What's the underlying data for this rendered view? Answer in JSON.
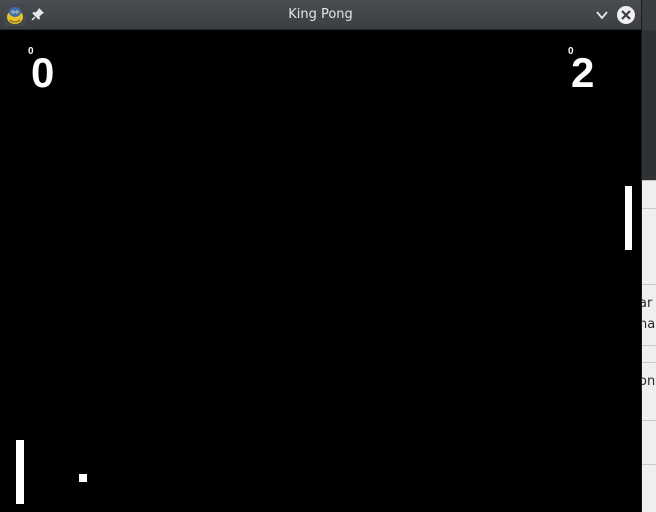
{
  "window": {
    "title": "King Pong",
    "app_icon": "pygame-snake-icon",
    "controls": [
      "pin-icon",
      "chevron-down-icon",
      "close-icon"
    ]
  },
  "game": {
    "left_score": "0",
    "left_small_score": "0",
    "right_score": "2",
    "right_small_score": "0",
    "colors": {
      "background": "#000000",
      "foreground": "#ffffff"
    }
  },
  "background_window": {
    "fragments": [
      "ar",
      "ha",
      "on"
    ]
  }
}
